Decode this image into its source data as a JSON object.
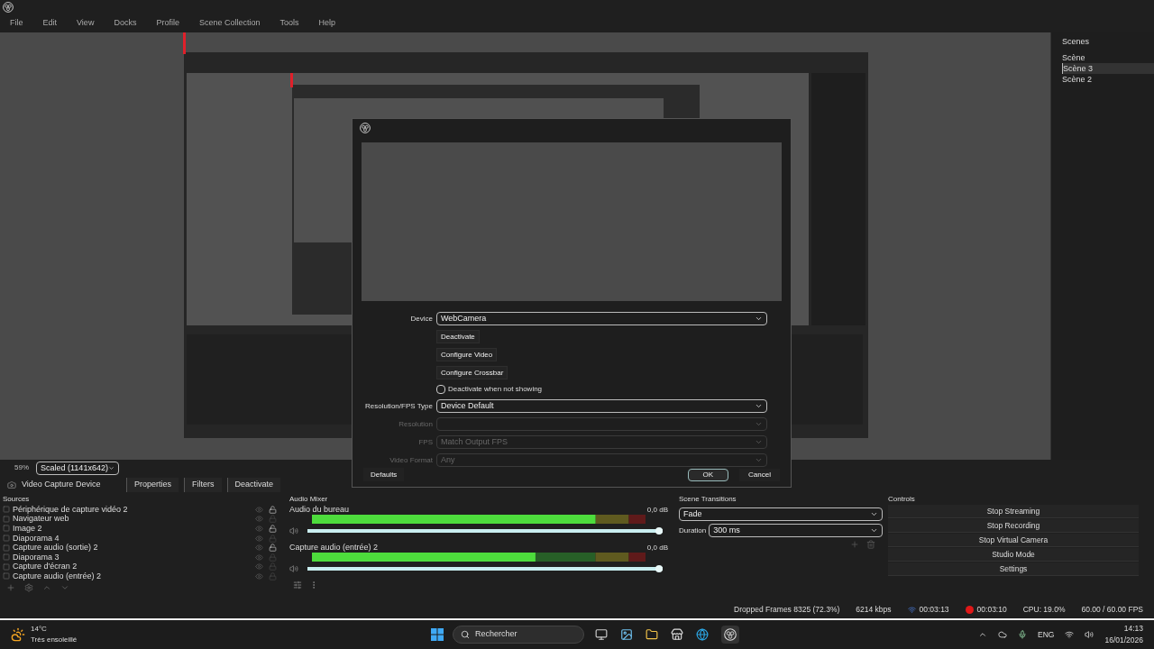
{
  "menu": [
    "File",
    "Edit",
    "View",
    "Docks",
    "Profile",
    "Scene Collection",
    "Tools",
    "Help"
  ],
  "scenes": {
    "title": "Scenes",
    "items": [
      {
        "label": "Scène",
        "selected": false
      },
      {
        "label": "Scène 3",
        "selected": true
      },
      {
        "label": "Scène 2",
        "selected": false
      }
    ]
  },
  "dialog": {
    "device_label": "Device",
    "device": "WebCamera",
    "buttons": [
      "Deactivate",
      "Configure Video",
      "Configure Crossbar"
    ],
    "checkbox": {
      "label": "Deactivate when not showing",
      "checked": false
    },
    "fields": [
      {
        "label": "Resolution/FPS Type",
        "value": "Device Default",
        "disabled": false
      },
      {
        "label": "Resolution",
        "disabled": true
      },
      {
        "label": "FPS",
        "value": "Match Output FPS",
        "disabled": true
      },
      {
        "label": "Video Format",
        "value": "Any",
        "disabled": true
      }
    ],
    "defaults": "Defaults",
    "ok": "OK",
    "cancel": "Cancel"
  },
  "preview": {
    "zoom": "59%",
    "scale": "Scaled (1141x642)"
  },
  "source_toolbar": {
    "source": "Video Capture Device",
    "buttons": [
      "Properties",
      "Filters",
      "Deactivate"
    ]
  },
  "sources": {
    "title": "Sources",
    "items": [
      {
        "label": "Périphérique de capture vidéo 2",
        "visible": true,
        "locked": false
      },
      {
        "label": "Navigateur web",
        "visible": true,
        "locked": true
      },
      {
        "label": "Image 2",
        "visible": true,
        "locked": false
      },
      {
        "label": "Diaporama 4",
        "visible": true,
        "locked": true
      },
      {
        "label": "Capture audio (sortie) 2",
        "visible": true,
        "locked": false
      },
      {
        "label": "Diaporama 3",
        "visible": true,
        "locked": true
      },
      {
        "label": "Capture d'écran 2",
        "visible": true,
        "locked": true
      },
      {
        "label": "Capture audio (entrée) 2",
        "visible": true,
        "locked": true
      }
    ]
  },
  "audio_mixer": {
    "title": "Audio Mixer",
    "channels": [
      {
        "name": "Audio du bureau",
        "reading": "0,0 dB",
        "level": 0.85,
        "volume_slider": {
          "level": 1
        }
      },
      {
        "name": "Capture audio (entrée) 2",
        "reading": "0,0 dB",
        "level": 0.67,
        "volume_slider": {
          "level": 1
        }
      }
    ]
  },
  "scene_transitions": {
    "title": "Scene Transitions",
    "transition": "Fade",
    "duration_label": "Duration",
    "duration": "300 ms"
  },
  "controls": {
    "title": "Controls",
    "buttons": [
      "Stop Streaming",
      "Stop Recording",
      "Stop Virtual Camera",
      "Studio Mode",
      "Settings"
    ]
  },
  "status": {
    "dropped": "Dropped Frames 8325 (72.3%)",
    "bitrate": "6214 kbps",
    "stream_time": "00:03:13",
    "rec_time": "00:03:10",
    "cpu": "CPU: 19.0%",
    "fps": "60.00 / 60.00 FPS"
  },
  "taskbar": {
    "temp": "14°C",
    "weather": "Très ensoleillé",
    "search": "Rechercher",
    "lang": "ENG",
    "time": "14:13",
    "date": "16/01/2026"
  }
}
